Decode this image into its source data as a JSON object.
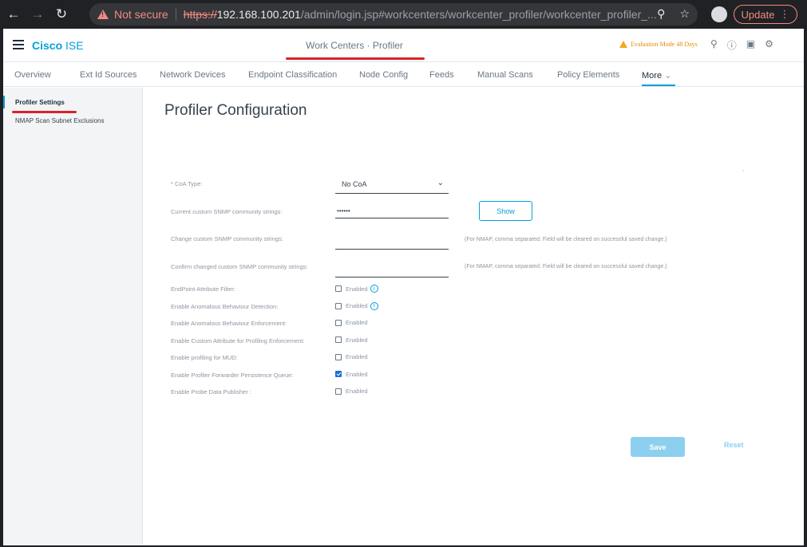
{
  "browser": {
    "security_label": "Not secure",
    "url_scheme": "https://",
    "url_host": "192.168.100.201",
    "url_path": "/admin/login.jsp#workcenters/workcenter_profiler/workcenter_profiler_...",
    "update_label": "Update"
  },
  "header": {
    "brand_bold": "Cisco",
    "brand_rest": " ISE",
    "page_title": "Work Centers · Profiler",
    "eval_label": "Evaluation Mode 48 Days"
  },
  "tabs": [
    {
      "label": "Overview"
    },
    {
      "label": "Ext Id Sources"
    },
    {
      "label": "Network Devices"
    },
    {
      "label": "Endpoint Classification"
    },
    {
      "label": "Node Config"
    },
    {
      "label": "Feeds"
    },
    {
      "label": "Manual Scans"
    },
    {
      "label": "Policy Elements"
    },
    {
      "label": "More"
    }
  ],
  "sidebar": {
    "items": [
      {
        "label": "Profiler Settings"
      },
      {
        "label": "NMAP Scan Subnet Exclusions"
      }
    ]
  },
  "main": {
    "title": "Profiler Configuration",
    "coa_label": "* CoA Type:",
    "coa_value": "No CoA",
    "current_snmp_label": "Current custom SNMP community strings:",
    "current_snmp_value": "••••••",
    "show_label": "Show",
    "change_snmp_label": "Change custom SNMP community strings:",
    "confirm_snmp_label": "Confirm changed custom SNMP community strings:",
    "change_hint": "(For NMAP, comma separated. Field will be cleared on successful saved change.)",
    "confirm_hint": "(For NMAP, comma separated. Field will be cleared on successful saved change.)",
    "enabled_text": "Enabled",
    "options": [
      {
        "label": "EndPoint Attribute Filter:",
        "checked": false,
        "info": true
      },
      {
        "label": "Enable Anomalous Behaviour Detection:",
        "checked": false,
        "info": true
      },
      {
        "label": "Enable Anomalous Behaviour Enforcement:",
        "checked": false,
        "info": false
      },
      {
        "label": "Enable Custom Attribute for Profiling Enforcement:",
        "checked": false,
        "info": false
      },
      {
        "label": "Enable profiling for MUD:",
        "checked": false,
        "info": false
      },
      {
        "label": "Enable Profiler Forwarder Persistence Queue:",
        "checked": true,
        "info": false
      },
      {
        "label": "Enable Probe Data Publisher :",
        "checked": false,
        "info": false
      }
    ],
    "save_label": "Save",
    "reset_label": "Reset"
  },
  "colors": {
    "brand": "#049fd9",
    "accent_red": "#d8232a",
    "warning": "#f5a623"
  }
}
